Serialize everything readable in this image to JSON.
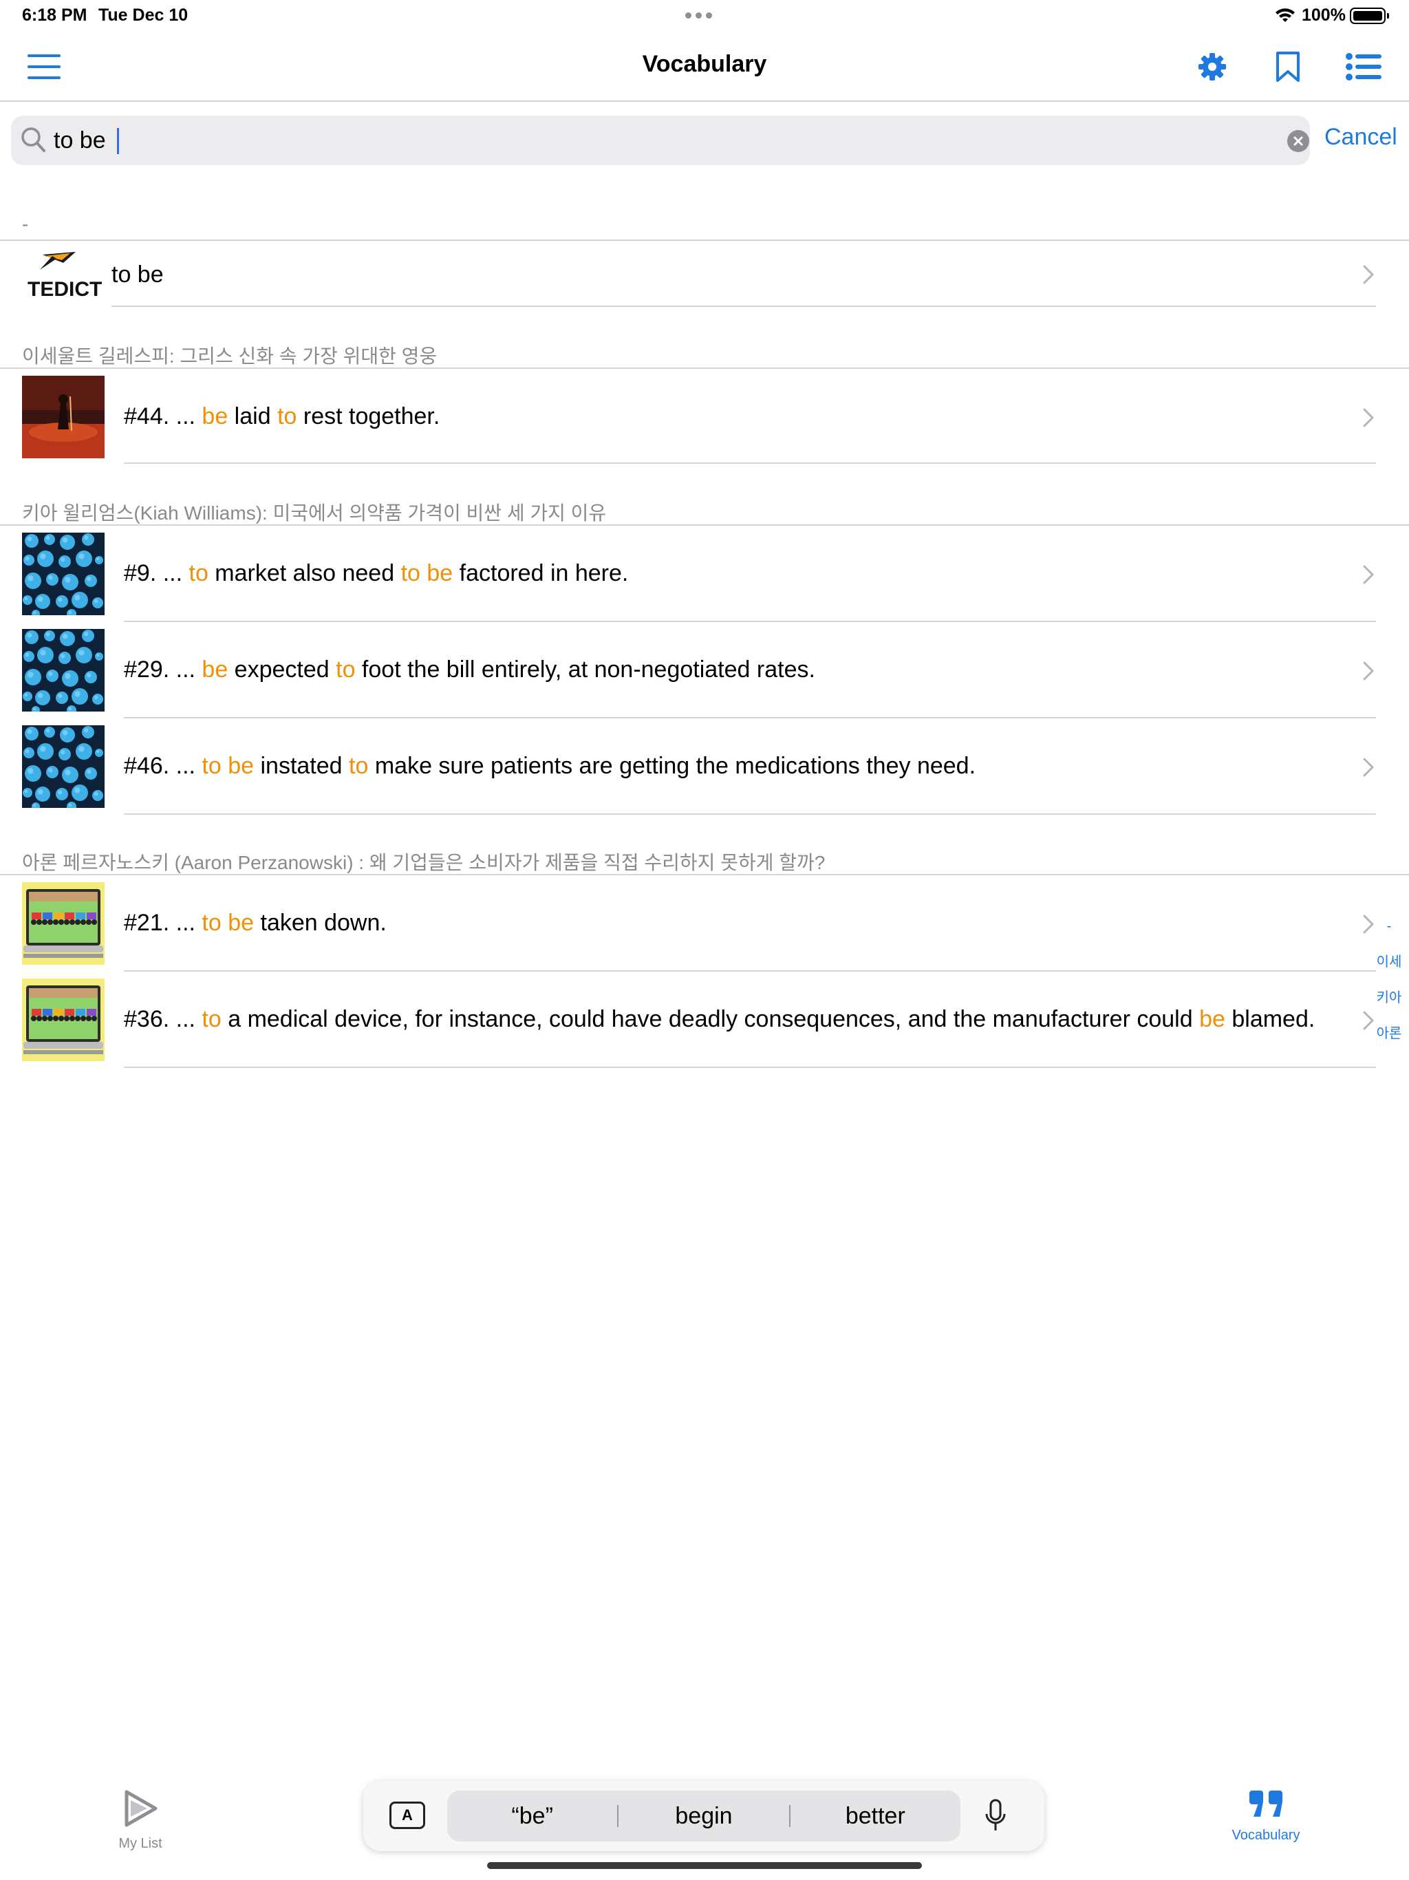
{
  "status_bar": {
    "time": "6:18 PM",
    "date": "Tue Dec 10",
    "battery": "100%"
  },
  "nav": {
    "title": "Vocabulary",
    "icons": [
      "menu-icon",
      "gear-icon",
      "bookmark-icon",
      "list-icon"
    ],
    "accent_color": "#1f7ae0"
  },
  "search": {
    "value": "to be",
    "cancel_label": "Cancel"
  },
  "highlight_color": "#f0900a",
  "sections": [
    {
      "header": "-",
      "rows": [
        {
          "thumb": "tedict-logo",
          "logo_text": "TEDICT",
          "text": "to be"
        }
      ]
    },
    {
      "header": "이세울트 길레스피: 그리스 신화 속 가장 위대한 영웅",
      "rows": [
        {
          "thumb": "hero-illustration",
          "prefix": "#44. ... ",
          "parts": [
            "be",
            " laid ",
            "to",
            " rest together."
          ]
        }
      ]
    },
    {
      "header": "키아 윌리엄스(Kiah Williams): 미국에서 의약품 가격이 비싼 세 가지 이유",
      "rows": [
        {
          "thumb": "bubbles-pattern",
          "prefix": "#9. ... ",
          "parts": [
            "to",
            " market also need ",
            "to",
            " ",
            "be",
            " factored in here."
          ]
        },
        {
          "thumb": "bubbles-pattern",
          "prefix": "#29. ... ",
          "parts": [
            "be",
            " expected ",
            "to",
            " foot the bill entirely, at non-negotiated rates."
          ]
        },
        {
          "thumb": "bubbles-pattern",
          "prefix": "#46. ... ",
          "parts": [
            "to",
            " ",
            "be",
            " instated ",
            "to",
            " make sure patients are getting the medications they need."
          ]
        }
      ]
    },
    {
      "header": "아론 페르자노스키 (Aaron Perzanowski) : 왜 기업들은 소비자가 제품을 직접 수리하지 못하게 할까?",
      "rows": [
        {
          "thumb": "laptop-tractors",
          "prefix": "#21. ... ",
          "parts": [
            "to",
            " ",
            "be",
            " taken down."
          ]
        },
        {
          "thumb": "laptop-tractors",
          "prefix": "#36. ... ",
          "parts": [
            "to",
            " a medical device, for instance, could have deadly consequences, and the manufacturer could ",
            "be",
            " blamed."
          ]
        }
      ]
    }
  ],
  "section_index": [
    "-",
    "이세",
    "키아",
    "아론"
  ],
  "tabbar": {
    "left_label": "My List",
    "right_label": "Vocabulary"
  },
  "keyboard_suggestions": [
    "“be”",
    "begin",
    "better"
  ],
  "keyboard_icon_label": "A"
}
